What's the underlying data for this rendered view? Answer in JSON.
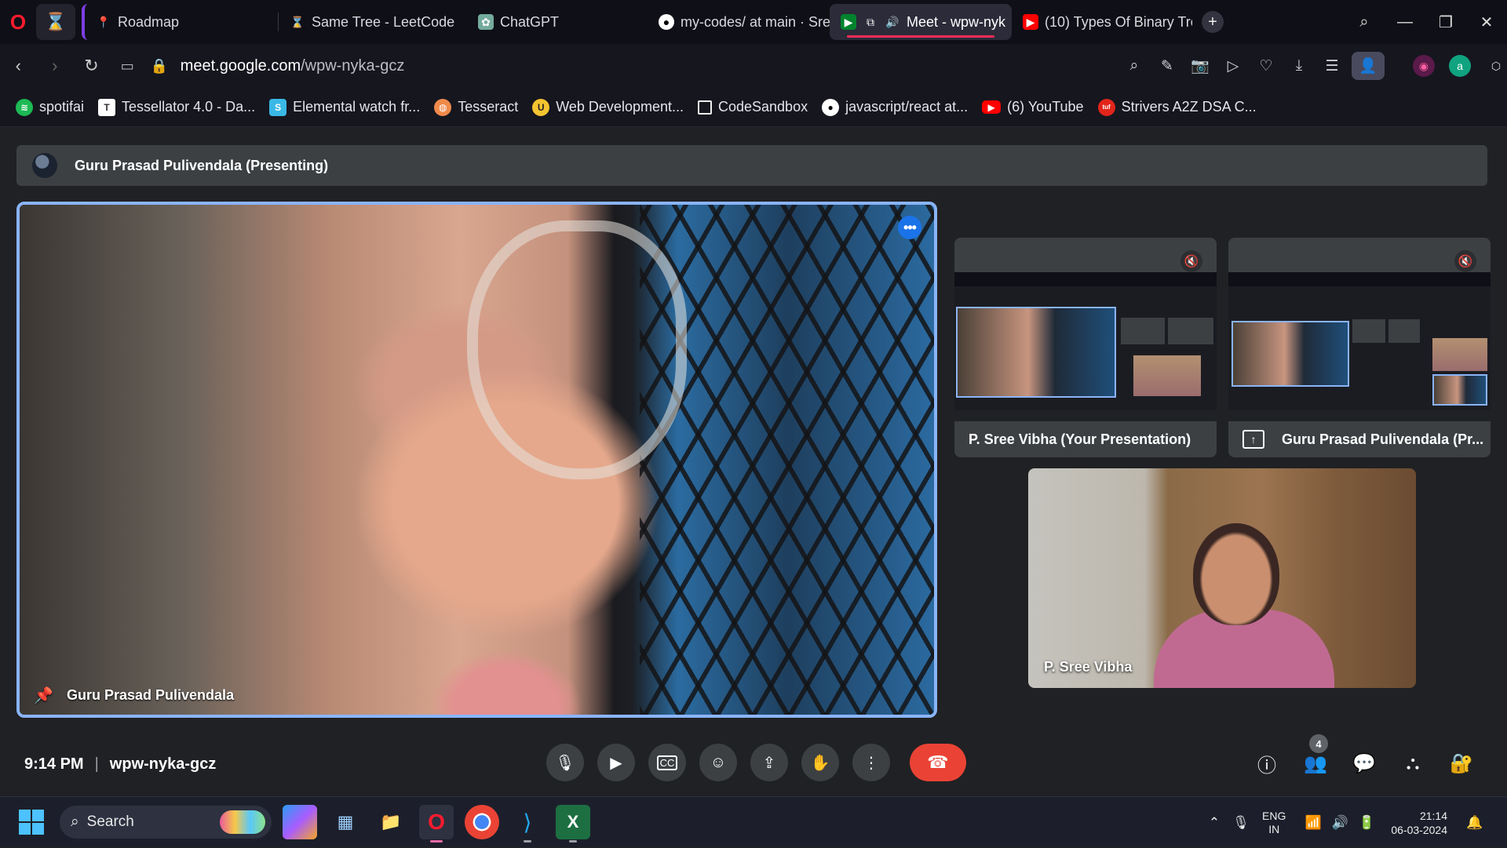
{
  "browser": {
    "tabs": [
      {
        "label": "Roadmap",
        "icon": "roadmap-pin-icon",
        "active": false
      },
      {
        "label": "Same Tree - LeetCode",
        "icon": "leetcode-icon",
        "active": false
      },
      {
        "label": "ChatGPT",
        "icon": "chatgpt-icon",
        "active": false
      },
      {
        "label": "my-codes/ at main · Sre",
        "icon": "github-icon",
        "active": false
      },
      {
        "label": "Meet - wpw-nyk",
        "icon": "meet-icon",
        "active": true
      },
      {
        "label": "(10) Types Of Binary Tre",
        "icon": "youtube-icon",
        "active": false
      }
    ],
    "url_domain": "meet.google.com",
    "url_path": "/wpw-nyka-gcz",
    "bookmarks": [
      {
        "label": "spotifai",
        "icon": "spotify-icon",
        "color": "#1db954"
      },
      {
        "label": "Tessellator 4.0 - Da...",
        "icon": "tessellator-icon",
        "color": "#ffffff"
      },
      {
        "label": "Elemental watch fr...",
        "icon": "elemental-icon",
        "color": "#3ab8e6"
      },
      {
        "label": "Tesseract",
        "icon": "tesseract-icon",
        "color": "#f08a4b"
      },
      {
        "label": "Web Development...",
        "icon": "webdev-icon",
        "color": "#f4c430"
      },
      {
        "label": "CodeSandbox",
        "icon": "codesandbox-icon",
        "color": "#1f1f1f"
      },
      {
        "label": "javascript/react at...",
        "icon": "github-icon",
        "color": "#ffffff"
      },
      {
        "label": "(6) YouTube",
        "icon": "youtube-icon",
        "color": "#ff0000"
      },
      {
        "label": "Strivers A2Z DSA C...",
        "icon": "takeuforward-icon",
        "color": "#e1251b"
      }
    ]
  },
  "meet": {
    "presenting_banner": "Guru Prasad Pulivendala (Presenting)",
    "main_tile_name": "Guru Prasad Pulivendala",
    "presentation_tiles": [
      {
        "label": "P. Sree Vibha (Your Presentation)"
      },
      {
        "label": "Guru Prasad Pulivendala (Pr..."
      }
    ],
    "participant_tile_name": "P. Sree Vibha",
    "time": "9:14 PM",
    "separator": "|",
    "meeting_code": "wpw-nyka-gcz",
    "participant_count": "4",
    "accent_color": "#8ab4f8",
    "end_call_color": "#ea4335"
  },
  "taskbar": {
    "search_placeholder": "Search",
    "language_top": "ENG",
    "language_bottom": "IN",
    "clock_time": "21:14",
    "clock_date": "06-03-2024"
  }
}
